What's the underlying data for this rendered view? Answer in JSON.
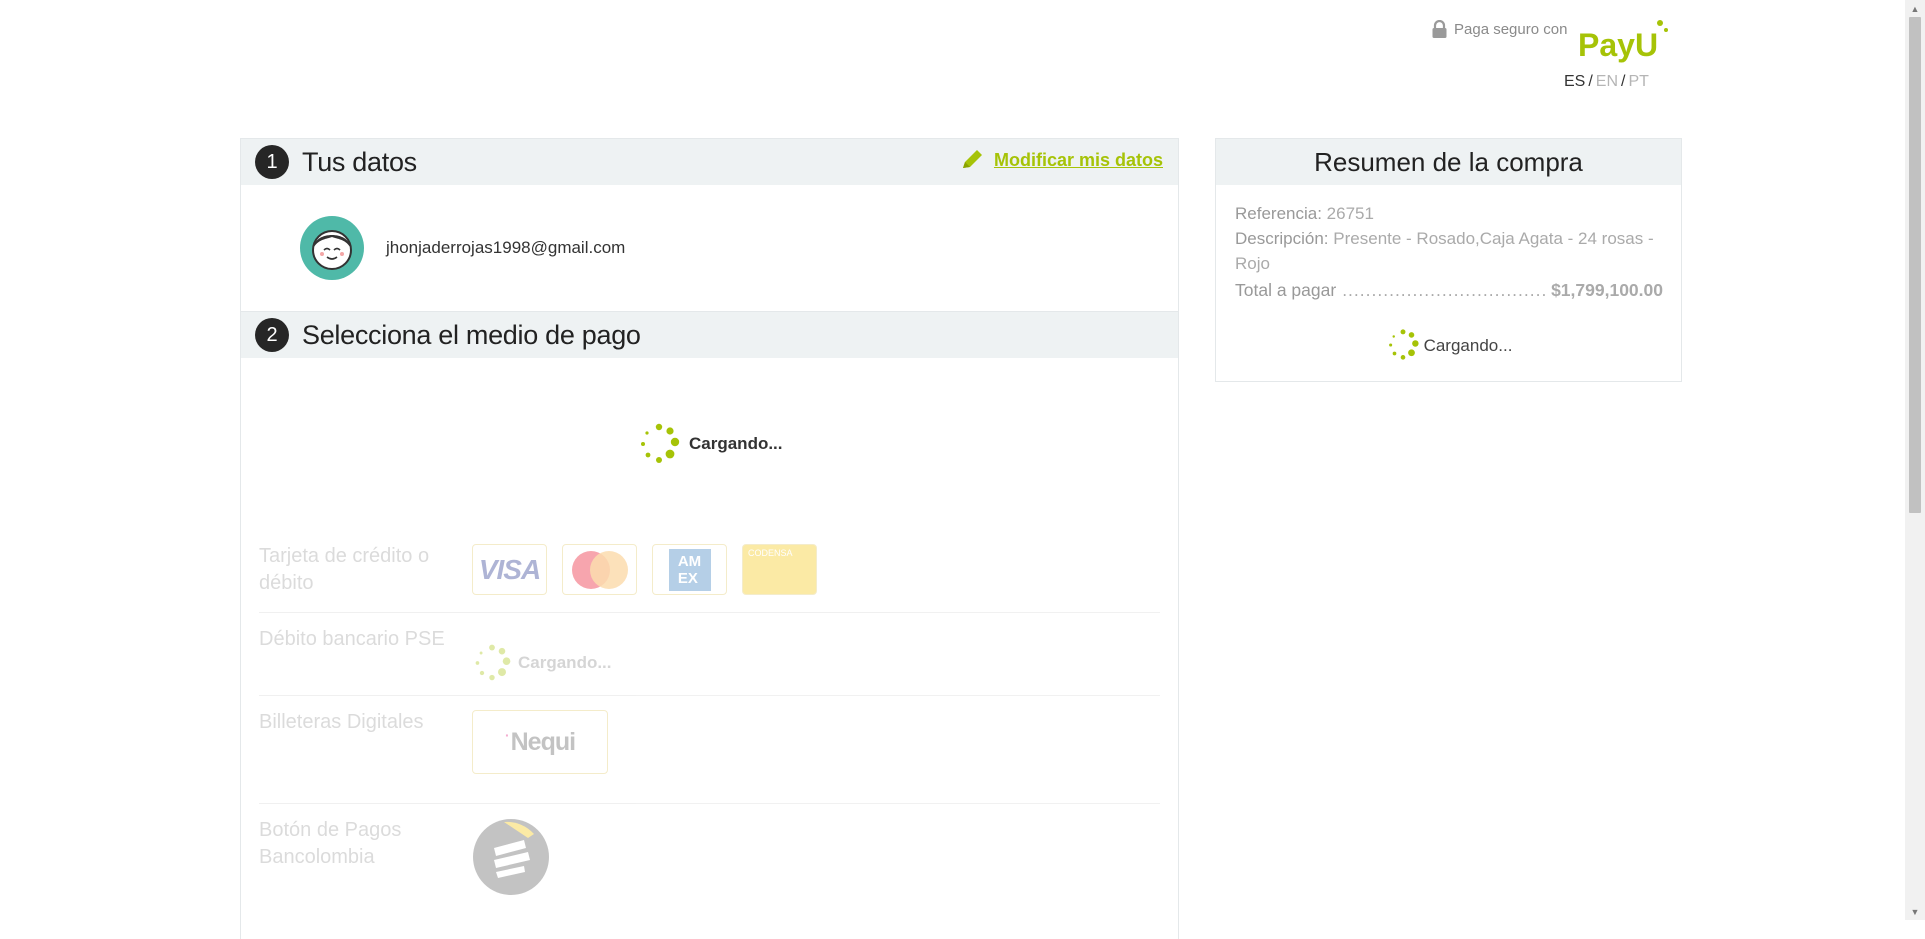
{
  "header": {
    "secure_text": "Paga seguro con",
    "logo_text": "PayU",
    "languages": [
      "ES",
      "EN",
      "PT"
    ],
    "active_language": "ES"
  },
  "section1": {
    "number": "1",
    "title": "Tus datos",
    "modify_label": "Modificar mis datos",
    "email": "jhonjaderrojas1998@gmail.com"
  },
  "section2": {
    "number": "2",
    "title": "Selecciona el medio de pago",
    "loading": "Cargando...",
    "methods": [
      {
        "label": "Tarjeta de crédito o débito",
        "cards": [
          "VISA",
          "MasterCard",
          "AMEX",
          "CODENSA"
        ]
      },
      {
        "label": "Débito bancario PSE",
        "loading": "Cargando..."
      },
      {
        "label": "Billeteras Digitales",
        "wallet": "Nequi"
      },
      {
        "label": "Botón de Pagos Bancolombia"
      }
    ]
  },
  "summary": {
    "title": "Resumen de la compra",
    "reference_label": "Referencia:",
    "reference_value": "26751",
    "description_label": "Descripción:",
    "description_value": "Presente - Rosado,Caja Agata - 24 rosas - Rojo",
    "total_label": "Total a pagar",
    "total_value": "$1,799,100.00",
    "loading": "Cargando..."
  },
  "colors": {
    "accent": "#a6c307",
    "header_bg": "#eef2f3",
    "avatar_bg": "#4fb9a8"
  }
}
